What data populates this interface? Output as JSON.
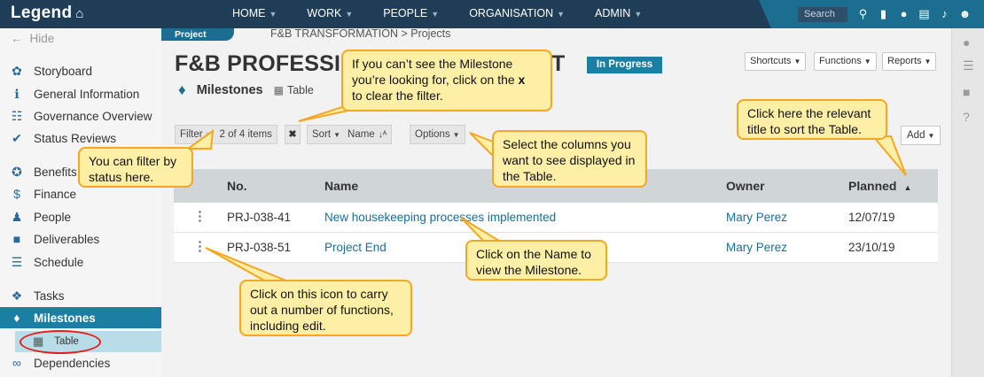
{
  "app": {
    "logo": "Legend"
  },
  "topnav": [
    "HOME",
    "WORK",
    "PEOPLE",
    "ORGANISATION",
    "ADMIN"
  ],
  "search": {
    "placeholder": "Search"
  },
  "sidebar": {
    "hide_label": "Hide",
    "items": [
      "Storyboard",
      "General Information",
      "Governance Overview",
      "Status Reviews",
      "Benefits",
      "Finance",
      "People",
      "Deliverables",
      "Schedule",
      "Tasks",
      "Milestones",
      "Table",
      "Dependencies"
    ]
  },
  "header": {
    "section_tab": "Project",
    "breadcrumb": "F&B TRANSFORMATION > Projects",
    "title_start": "F&B PROFESSIC",
    "title_end": "T",
    "status": "In Progress",
    "buttons": {
      "shortcuts": "Shortcuts",
      "functions": "Functions",
      "reports": "Reports",
      "add": "Add"
    },
    "subview_title": "Milestones",
    "subview_mode": "Table"
  },
  "toolbar": {
    "filter": "Filter",
    "filter_count": "2 of 4 items",
    "clear": "✖",
    "sort": "Sort",
    "sort_by": "Name",
    "options": "Options"
  },
  "table": {
    "columns": [
      "No.",
      "Name",
      "Owner",
      "Planned"
    ],
    "rows": [
      {
        "no": "PRJ-038-41",
        "name": "New housekeeping processes implemented",
        "owner": "Mary Perez",
        "planned": "12/07/19"
      },
      {
        "no": "PRJ-038-51",
        "name": "Project End",
        "owner": "Mary Perez",
        "planned": "23/10/19"
      }
    ]
  },
  "callouts": {
    "milestone_filter_1": "If you can’t see the Milestone",
    "milestone_filter_2": "you’re looking for, click on the",
    "milestone_filter_x": "x",
    "milestone_filter_3": "to clear the filter.",
    "status_filter": "You can filter by status here.",
    "columns": "Select the columns you want to see displayed in the Table.",
    "sort": "Click here the relevant title to sort the Table.",
    "name": "Click on the Name to view the Milestone.",
    "kebab": "Click on this icon to carry out a number of functions, including edit."
  },
  "colors": {
    "topbar": "#1f3d57",
    "accent": "#1b7fa3",
    "callout_fill": "#fdf0a6",
    "callout_border": "#f5a623",
    "highlight": "#e0201c"
  }
}
